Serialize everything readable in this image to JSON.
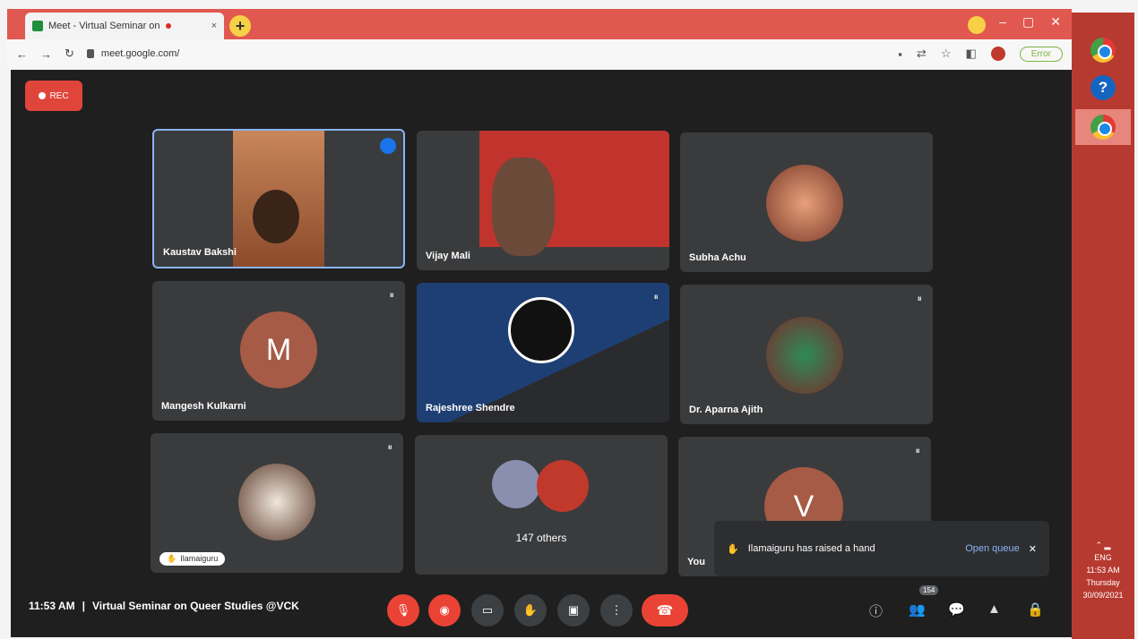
{
  "browser": {
    "tab_title": "Meet - Virtual Seminar on",
    "tab_close": "×",
    "new_tab": "+",
    "url": "meet.google.com/",
    "profile_pill": "Error",
    "window_controls": [
      "–",
      "▢",
      "✕"
    ]
  },
  "meet": {
    "rec_label": "REC",
    "tiles": [
      {
        "name": "Kaustav Bakshi"
      },
      {
        "name": "Vijay Mali"
      },
      {
        "name": "Subha Achu"
      },
      {
        "name": "Mangesh Kulkarni",
        "initial": "M"
      },
      {
        "name": "Rajeshree Shendre"
      },
      {
        "name": "Dr. Aparna Ajith"
      },
      {
        "chip": "Ilamaiguru"
      },
      {
        "others_label": "147 others"
      },
      {
        "name": "You",
        "initial": "V"
      }
    ],
    "toast": {
      "text": "Ilamaiguru has raised a hand",
      "action": "Open queue",
      "close": "✕"
    },
    "footer": {
      "time": "11:53 AM",
      "separator": "|",
      "meeting_title": "Virtual Seminar on Queer Studies @VCK"
    },
    "people_count": "154"
  },
  "taskbar": {
    "tray_lang": "ENG",
    "tray_time": "11:53 AM",
    "tray_day": "Thursday",
    "tray_date": "30/09/2021"
  },
  "colors": {
    "accent_red": "#ea4335",
    "meet_bg": "#1f1f1f",
    "tile_bg": "#3a3b3d",
    "link_blue": "#8ab4f8"
  },
  "icons": [
    "mic-icon",
    "camera-icon",
    "captions-icon",
    "raise-hand-icon",
    "present-icon",
    "more-icon",
    "end-call-icon",
    "info-icon",
    "people-icon",
    "chat-icon",
    "activities-icon",
    "host-controls-icon"
  ]
}
